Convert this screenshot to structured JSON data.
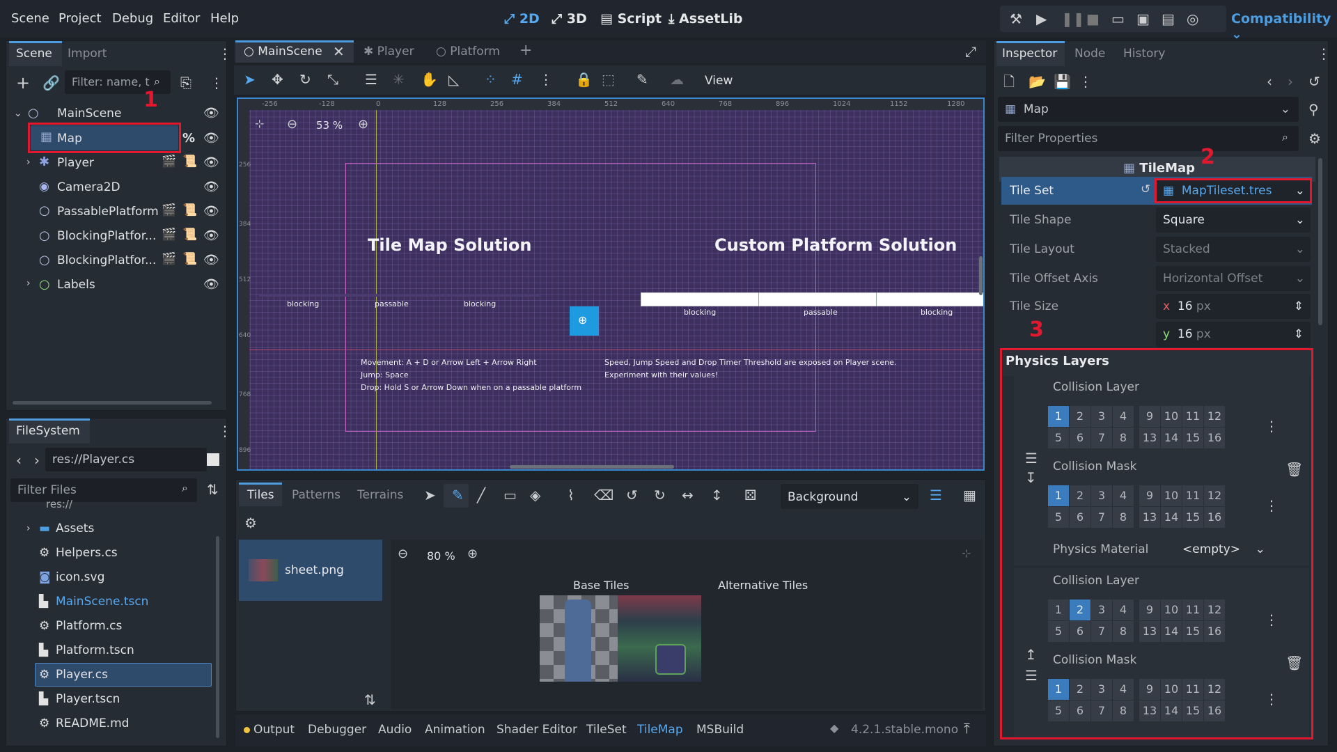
{
  "menu": [
    "Scene",
    "Project",
    "Debug",
    "Editor",
    "Help"
  ],
  "workspaces": {
    "w2d": "2D",
    "w3d": "3D",
    "script": "Script",
    "assetlib": "AssetLib"
  },
  "renderer": "Compatibility",
  "scene_dock": {
    "tabs": [
      "Scene",
      "Import"
    ],
    "filter_placeholder": "Filter: name, t",
    "tree": [
      "MainScene",
      "Map",
      "Player",
      "Camera2D",
      "PassablePlatform",
      "BlockingPlatfor...",
      "BlockingPlatfor...",
      "Labels"
    ],
    "percent": "%"
  },
  "filesystem": {
    "tab": "FileSystem",
    "path": "res://Player.cs",
    "filter_placeholder": "Filter Files",
    "root": "res://",
    "files": [
      "Assets",
      "Helpers.cs",
      "icon.svg",
      "MainScene.tscn",
      "Platform.cs",
      "Platform.tscn",
      "Player.cs",
      "Player.tscn",
      "README.md"
    ]
  },
  "editor_tabs": [
    "MainScene",
    "Player",
    "Platform"
  ],
  "toolbar": {
    "view": "View"
  },
  "viewport": {
    "zoom": "53 %",
    "ruler": [
      "-256",
      "-128",
      "0",
      "128",
      "256",
      "384",
      "512",
      "640",
      "768",
      "896",
      "1024",
      "1152",
      "1280"
    ],
    "vruler": [
      "256",
      "384",
      "512",
      "640",
      "768",
      "896"
    ],
    "title_left": "Tile Map Solution",
    "title_right": "Custom Platform Solution",
    "left_labels": [
      "blocking",
      "passable",
      "blocking"
    ],
    "right_labels": [
      "blocking",
      "passable",
      "blocking"
    ],
    "help_left": [
      "Movement: A + D or Arrow Left + Arrow Right",
      "Jump: Space",
      "Drop: Hold S or Arrow Down when on a passable platform"
    ],
    "help_right": [
      "Speed, Jump Speed and Drop Timer Threshold are exposed on Player scene.",
      "Experiment with their values!"
    ]
  },
  "tilemap_panel": {
    "tabs": [
      "Tiles",
      "Patterns",
      "Terrains"
    ],
    "layer": "Background",
    "source": "sheet.png",
    "zoom": "80 %",
    "base_tiles": "Base Tiles",
    "alt_tiles": "Alternative Tiles"
  },
  "bottom_tabs": [
    "Output",
    "Debugger",
    "Audio",
    "Animation",
    "Shader Editor",
    "TileSet",
    "TileMap",
    "MSBuild"
  ],
  "version": "4.2.1.stable.mono",
  "inspector": {
    "tabs": [
      "Inspector",
      "Node",
      "History"
    ],
    "object": "Map",
    "filter_placeholder": "Filter Properties",
    "class_name": "TileMap",
    "props": [
      {
        "label": "Tile Set",
        "value": "MapTileset.tres"
      },
      {
        "label": "Tile Shape",
        "value": "Square"
      },
      {
        "label": "Tile Layout",
        "value": "Stacked"
      },
      {
        "label": "Tile Offset Axis",
        "value": "Horizontal Offset"
      },
      {
        "label": "Tile Size",
        "x": "16",
        "y": "16",
        "unit": "px"
      }
    ],
    "physics_layers": "Physics Layers",
    "collision_layer": "Collision Layer",
    "collision_mask": "Collision Mask",
    "physics_material": "Physics Material",
    "empty": "<empty>",
    "grid_numbers": [
      "1",
      "2",
      "3",
      "4",
      "9",
      "10",
      "11",
      "12",
      "5",
      "6",
      "7",
      "8",
      "13",
      "14",
      "15",
      "16"
    ],
    "layer0": {
      "layer_on": [
        "1"
      ],
      "mask_on": [
        "1"
      ]
    },
    "layer1": {
      "layer_on": [
        "2"
      ],
      "mask_on": [
        "1"
      ]
    }
  },
  "annotations": [
    "1",
    "2",
    "3"
  ],
  "colors": {
    "accent": "#4d9de0",
    "red": "#e2182f",
    "viewport": "#3d2f5e"
  }
}
